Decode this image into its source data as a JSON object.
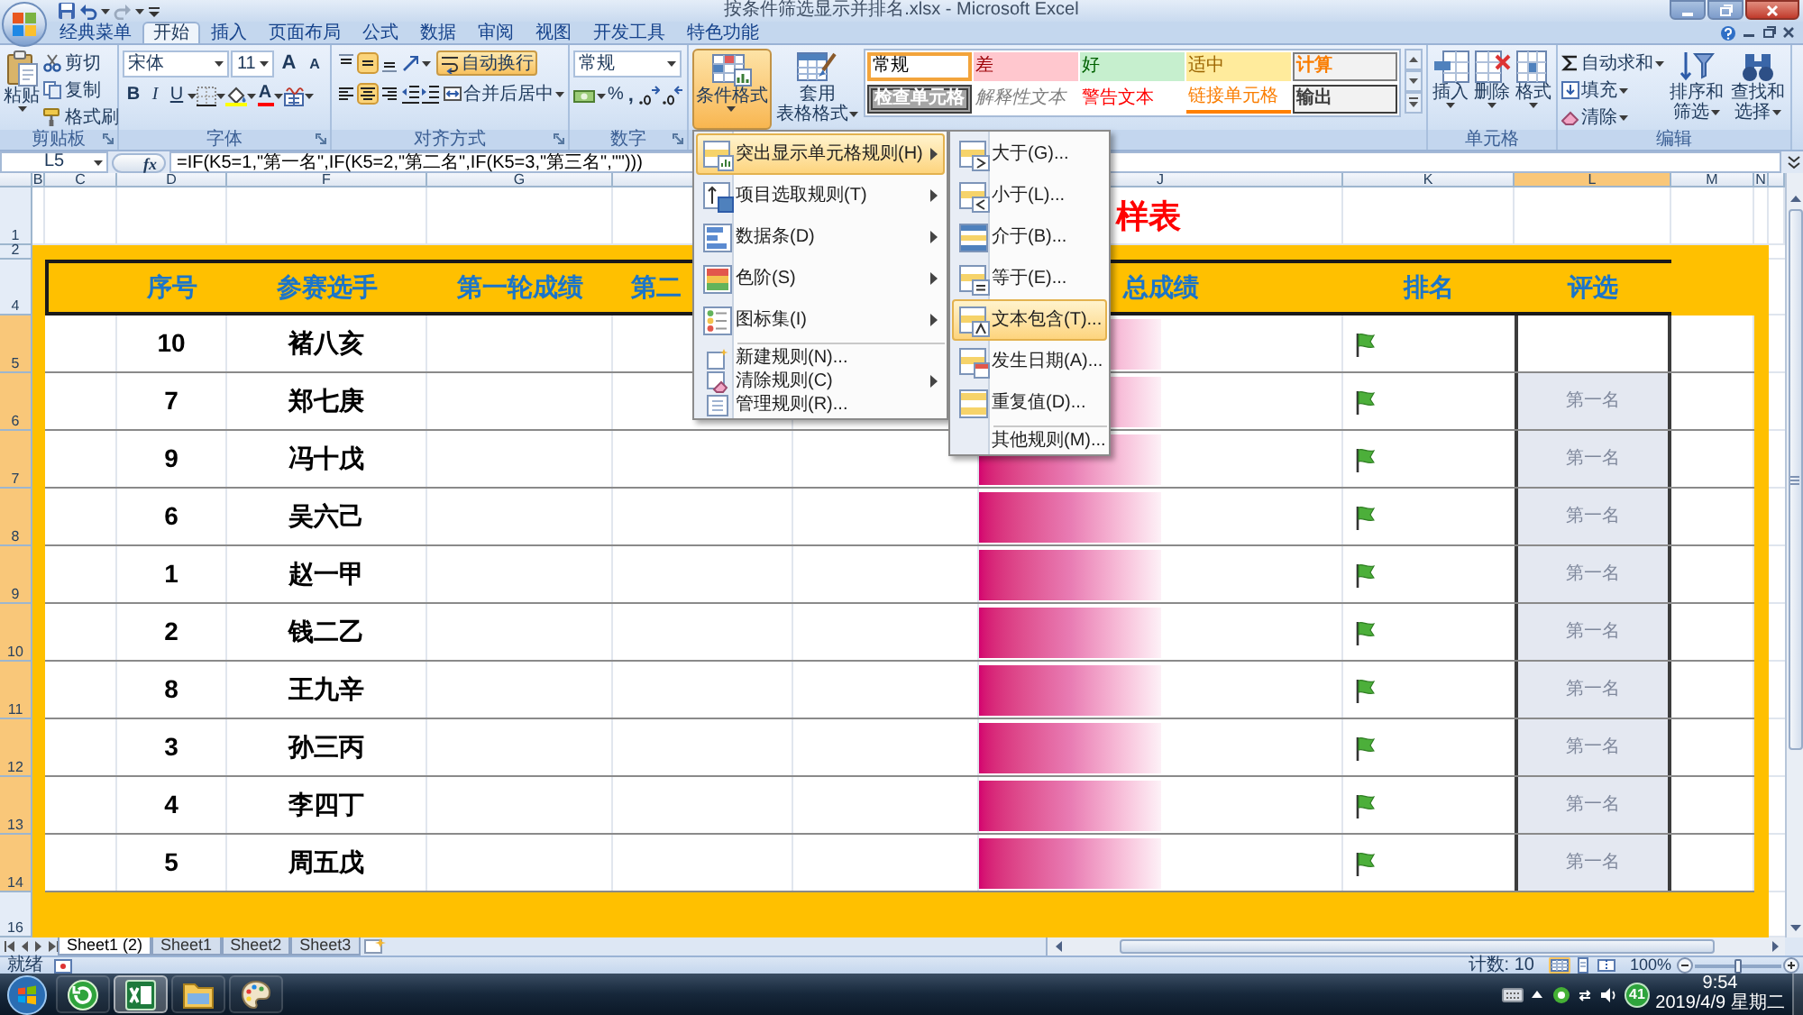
{
  "window": {
    "title": "按条件筛选显示并排名.xlsx - Microsoft Excel"
  },
  "ribbon_tabs": [
    {
      "label": "经典菜单",
      "selected": false
    },
    {
      "label": "开始",
      "selected": true
    },
    {
      "label": "插入",
      "selected": false
    },
    {
      "label": "页面布局",
      "selected": false
    },
    {
      "label": "公式",
      "selected": false
    },
    {
      "label": "数据",
      "selected": false
    },
    {
      "label": "审阅",
      "selected": false
    },
    {
      "label": "视图",
      "selected": false
    },
    {
      "label": "开发工具",
      "selected": false
    },
    {
      "label": "特色功能",
      "selected": false
    }
  ],
  "clipboard": {
    "label": "剪贴板",
    "paste": "粘贴",
    "commands": [
      {
        "kind": "cut",
        "label": "剪切"
      },
      {
        "kind": "copy",
        "label": "复制"
      },
      {
        "kind": "painter",
        "label": "格式刷"
      }
    ]
  },
  "font": {
    "label": "字体",
    "name": "宋体",
    "size": "11",
    "grow": "A",
    "shrink": "A",
    "formats": [
      {
        "kind": "bold",
        "label": "B"
      },
      {
        "kind": "italic",
        "label": "I"
      },
      {
        "kind": "underline",
        "label": "U"
      }
    ],
    "color_letter": "A"
  },
  "alignment": {
    "label": "对齐方式",
    "vertical": [
      {
        "kind": "top",
        "on": false
      },
      {
        "kind": "middle",
        "on": true
      },
      {
        "kind": "bottom",
        "on": false
      }
    ],
    "horizontal": [
      {
        "kind": "left",
        "on": false
      },
      {
        "kind": "center",
        "on": true
      },
      {
        "kind": "right",
        "on": false
      }
    ],
    "wrap_text": {
      "label": "自动换行",
      "on": true
    },
    "merge": "合并后居中"
  },
  "number": {
    "label": "数字",
    "format": "常规",
    "percent": "%",
    "comma": ","
  },
  "styles": {
    "conditional_format": {
      "label": "条件格式",
      "expanded": true
    },
    "table_format": [
      "套用",
      "表格格式"
    ],
    "cell_styles": [
      {
        "label": "常规",
        "kind": "normal",
        "selected": true
      },
      {
        "label": "差",
        "kind": "bad",
        "selected": false
      },
      {
        "label": "好",
        "kind": "good",
        "selected": false
      },
      {
        "label": "适中",
        "kind": "neutral",
        "selected": false
      },
      {
        "label": "计算",
        "kind": "calculation",
        "selected": false
      },
      {
        "label": "检查单元格",
        "kind": "check",
        "selected": false
      },
      {
        "label": "解释性文本",
        "kind": "explanatory",
        "selected": false
      },
      {
        "label": "警告文本",
        "kind": "warning",
        "selected": false
      },
      {
        "label": "链接单元格",
        "kind": "linked",
        "selected": false
      },
      {
        "label": "输出",
        "kind": "output",
        "selected": false
      }
    ]
  },
  "cells": {
    "label": "单元格",
    "buttons": [
      {
        "kind": "insert",
        "label": "插入"
      },
      {
        "kind": "delete",
        "label": "删除"
      },
      {
        "kind": "format",
        "label": "格式"
      }
    ]
  },
  "editing": {
    "label": "编辑",
    "commands": [
      {
        "kind": "sum",
        "label": "自动求和"
      },
      {
        "kind": "fill",
        "label": "填充"
      },
      {
        "kind": "clear",
        "label": "清除"
      }
    ],
    "buttons": [
      {
        "kind": "sort",
        "lines": [
          "排序和",
          "筛选"
        ]
      },
      {
        "kind": "find",
        "lines": [
          "查找和",
          "选择"
        ]
      }
    ]
  },
  "formula_bar": {
    "name_box": "L5",
    "function_label": "fx",
    "formula": "=IF(K5=1,\"第一名\",IF(K5=2,\"第二名\",IF(K5=3,\"第三名\",\"\")))"
  },
  "column_headers": [
    {
      "label": "B",
      "selected": false
    },
    {
      "label": "C",
      "selected": false
    },
    {
      "label": "D",
      "selected": false
    },
    {
      "label": "F",
      "selected": false
    },
    {
      "label": "G",
      "selected": false
    },
    {
      "label": "J",
      "selected": false
    },
    {
      "label": "K",
      "selected": false
    },
    {
      "label": "L",
      "selected": true
    },
    {
      "label": "M",
      "selected": false
    },
    {
      "label": "N",
      "selected": false
    }
  ],
  "row_headers": [
    {
      "label": "1",
      "selected": false
    },
    {
      "label": "2",
      "selected": false
    },
    {
      "label": "4",
      "selected": false
    },
    {
      "label": "5",
      "selected": true
    },
    {
      "label": "6",
      "selected": true
    },
    {
      "label": "7",
      "selected": true
    },
    {
      "label": "8",
      "selected": true
    },
    {
      "label": "9",
      "selected": true
    },
    {
      "label": "10",
      "selected": true
    },
    {
      "label": "11",
      "selected": true
    },
    {
      "label": "12",
      "selected": true
    },
    {
      "label": "13",
      "selected": true
    },
    {
      "label": "14",
      "selected": true
    },
    {
      "label": "16",
      "selected": false
    }
  ],
  "sheet": {
    "title": "样表",
    "headers": [
      "序号",
      "参赛选手",
      "第一轮成绩",
      "第二",
      "总成绩",
      "排名",
      "评选"
    ],
    "rows": [
      {
        "number": "10",
        "name": "褚八亥",
        "level": 0.5,
        "active": true
      },
      {
        "number": "7",
        "name": "郑七庚",
        "level": 0.5,
        "evaluation": "第一名",
        "active": false
      },
      {
        "number": "9",
        "name": "冯十戊",
        "level": 0.5,
        "evaluation": "第一名",
        "active": false
      },
      {
        "number": "6",
        "name": "吴六己",
        "level": 0.5,
        "evaluation": "第一名",
        "active": false
      },
      {
        "number": "1",
        "name": "赵一甲",
        "level": 0.5,
        "evaluation": "第一名",
        "active": false
      },
      {
        "number": "2",
        "name": "钱二乙",
        "level": 0.5,
        "evaluation": "第一名",
        "active": false
      },
      {
        "number": "8",
        "name": "王九辛",
        "level": 0.5,
        "evaluation": "第一名",
        "active": false
      },
      {
        "number": "3",
        "name": "孙三丙",
        "level": 0.5,
        "evaluation": "第一名",
        "active": false
      },
      {
        "number": "4",
        "name": "李四丁",
        "level": 0.5,
        "evaluation": "第一名",
        "active": false
      },
      {
        "number": "5",
        "name": "周五戊",
        "level": 0.5,
        "evaluation": "第一名",
        "active": false
      }
    ]
  },
  "conditional_menu": {
    "sections": [
      [
        {
          "label": "突出显示单元格规则(H)",
          "kind": "highlight",
          "submenu": true,
          "selected": true
        },
        {
          "label": "项目选取规则(T)",
          "kind": "top",
          "submenu": true,
          "selected": false
        },
        {
          "label": "数据条(D)",
          "kind": "databar",
          "submenu": true,
          "selected": false
        },
        {
          "label": "色阶(S)",
          "kind": "colorscale",
          "submenu": true,
          "selected": false
        },
        {
          "label": "图标集(I)",
          "kind": "iconset",
          "submenu": true,
          "selected": false
        }
      ],
      [
        {
          "label": "新建规则(N)...",
          "kind": "new",
          "submenu": false,
          "selected": false
        },
        {
          "label": "清除规则(C)",
          "kind": "clear",
          "submenu": true,
          "selected": false
        },
        {
          "label": "管理规则(R)...",
          "kind": "manage",
          "submenu": false,
          "selected": false
        }
      ]
    ]
  },
  "highlight_submenu": {
    "sections": [
      [
        {
          "label": "大于(G)...",
          "kind": "greater",
          "selected": false
        },
        {
          "label": "小于(L)...",
          "kind": "less",
          "selected": false
        },
        {
          "label": "介于(B)...",
          "kind": "between",
          "selected": false
        },
        {
          "label": "等于(E)...",
          "kind": "equal",
          "selected": false
        },
        {
          "label": "文本包含(T)...",
          "kind": "text",
          "selected": true
        },
        {
          "label": "发生日期(A)...",
          "kind": "date",
          "selected": false
        },
        {
          "label": "重复值(D)...",
          "kind": "duplicate",
          "selected": false
        }
      ],
      [
        {
          "label": "其他规则(M)...",
          "kind": "more",
          "selected": false
        }
      ]
    ]
  },
  "sheet_tabs": [
    {
      "label": "Sheet1 (2)",
      "selected": true
    },
    {
      "label": "Sheet1",
      "selected": false
    },
    {
      "label": "Sheet2",
      "selected": false
    },
    {
      "label": "Sheet3",
      "selected": false
    }
  ],
  "status_bar": {
    "mode": "就绪",
    "count": "计数: 10",
    "views": [
      {
        "kind": "normal",
        "selected": true
      },
      {
        "kind": "layout",
        "selected": false
      },
      {
        "kind": "preview",
        "selected": false
      }
    ],
    "zoom": "100%",
    "zoom_slider": {
      "level": 0.5
    }
  },
  "taskbar": {
    "apps": [
      {
        "kind": "browser",
        "selected": false
      },
      {
        "kind": "excel",
        "selected": true
      },
      {
        "kind": "folder",
        "selected": false
      },
      {
        "kind": "paint",
        "selected": false
      }
    ],
    "tray_badge": "41",
    "time": "9:54",
    "date": "2019/4/9 星期二"
  }
}
